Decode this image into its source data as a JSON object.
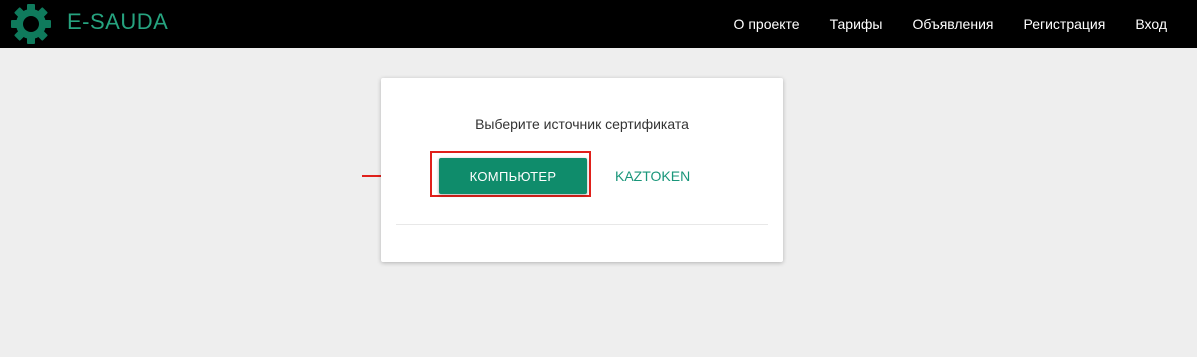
{
  "header": {
    "brand": "E-SAUDA",
    "logo_icon": "gear-logo-icon",
    "nav": [
      {
        "label": "О проекте"
      },
      {
        "label": "Тарифы"
      },
      {
        "label": "Объявления"
      },
      {
        "label": "Регистрация"
      },
      {
        "label": "Вход"
      }
    ]
  },
  "dialog": {
    "title": "Выберите источник сертификата",
    "computer_label": "КОМПЬЮТЕР",
    "kaztoken_label": "KAZTOKEN"
  },
  "colors": {
    "brand": "#26a37f",
    "primary_button": "#0f8c6b",
    "annotation": "#e0201b"
  }
}
